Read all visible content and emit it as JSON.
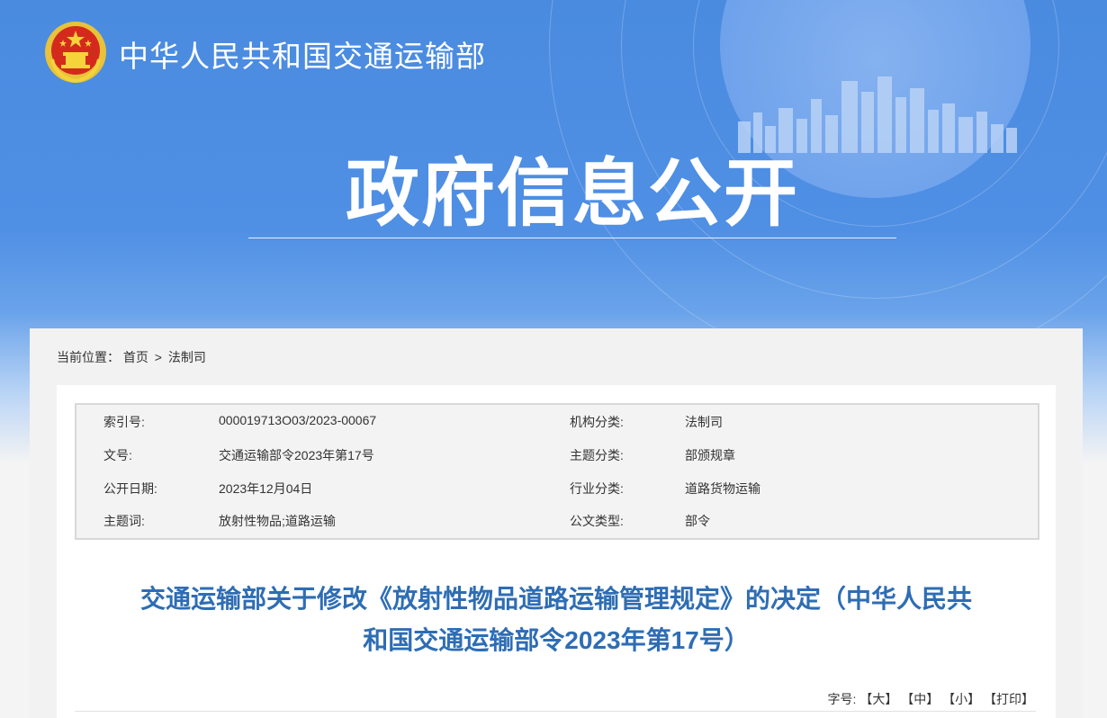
{
  "header": {
    "site_name": "中华人民共和国交通运输部",
    "banner_title": "政府信息公开"
  },
  "breadcrumb": {
    "label": "当前位置：",
    "items": [
      "首页",
      "法制司"
    ],
    "separator": ">"
  },
  "meta": {
    "rows": [
      {
        "label1": "索引号:",
        "value1": "000019713O03/2023-00067",
        "label2": "机构分类:",
        "value2": "法制司"
      },
      {
        "label1": "文号:",
        "value1": "交通运输部令2023年第17号",
        "label2": "主题分类:",
        "value2": "部颁规章"
      },
      {
        "label1": "公开日期:",
        "value1": "2023年12月04日",
        "label2": "行业分类:",
        "value2": "道路货物运输"
      },
      {
        "label1": "主题词:",
        "value1": "放射性物品;道路运输",
        "label2": "公文类型:",
        "value2": "部令"
      }
    ]
  },
  "article": {
    "title_line1": "交通运输部关于修改《放射性物品道路运输管理规定》的决定（中华人民共",
    "title_line2": "和国交通运输部令2023年第17号）"
  },
  "font_tools": {
    "label": "字号:",
    "large": "【大】",
    "medium": "【中】",
    "small": "【小】",
    "print": "【打印】"
  },
  "colors": {
    "banner_blue": "#4a8be0",
    "title_blue": "#2e6db4"
  }
}
